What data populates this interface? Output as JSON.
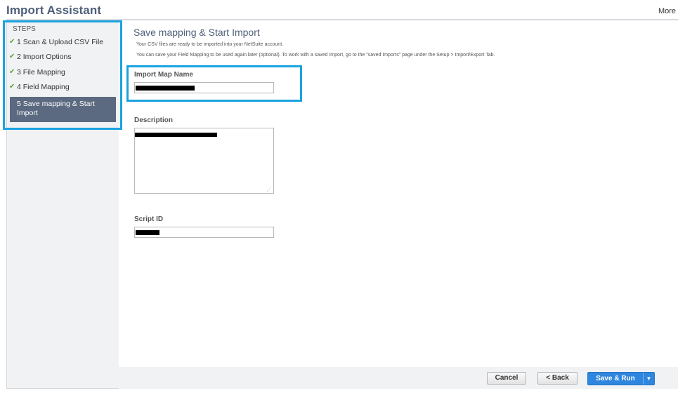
{
  "header": {
    "title": "Import Assistant",
    "more_label": "More"
  },
  "sidebar": {
    "heading": "STEPS",
    "items": [
      {
        "label": "1 Scan & Upload CSV File",
        "done": true
      },
      {
        "label": "2 Import Options",
        "done": true
      },
      {
        "label": "3 File Mapping",
        "done": true
      },
      {
        "label": "4 Field Mapping",
        "done": true
      }
    ],
    "active_label": "5 Save mapping & Start Import",
    "check_glyph": "✔"
  },
  "main": {
    "title": "Save mapping & Start Import",
    "note1": "Your CSV files are ready to be imported into your NetSuite account.",
    "note2": "You can save your Field Mapping to be used again later (optional). To work with a saved Import, go to the \"saved Imports\" page under the Setup > Import/Export Tab.",
    "import_map_name_label": "Import Map Name",
    "description_label": "Description",
    "script_id_label": "Script ID"
  },
  "footer": {
    "cancel_label": "Cancel",
    "back_label": "< Back",
    "save_run_label": "Save & Run",
    "dropdown_glyph": "▼"
  },
  "colors": {
    "accent": "#1aa3e0",
    "title": "#4d5f79",
    "active_step": "#5b6a80",
    "primary_button": "#2f86de",
    "check": "#5aa335"
  }
}
